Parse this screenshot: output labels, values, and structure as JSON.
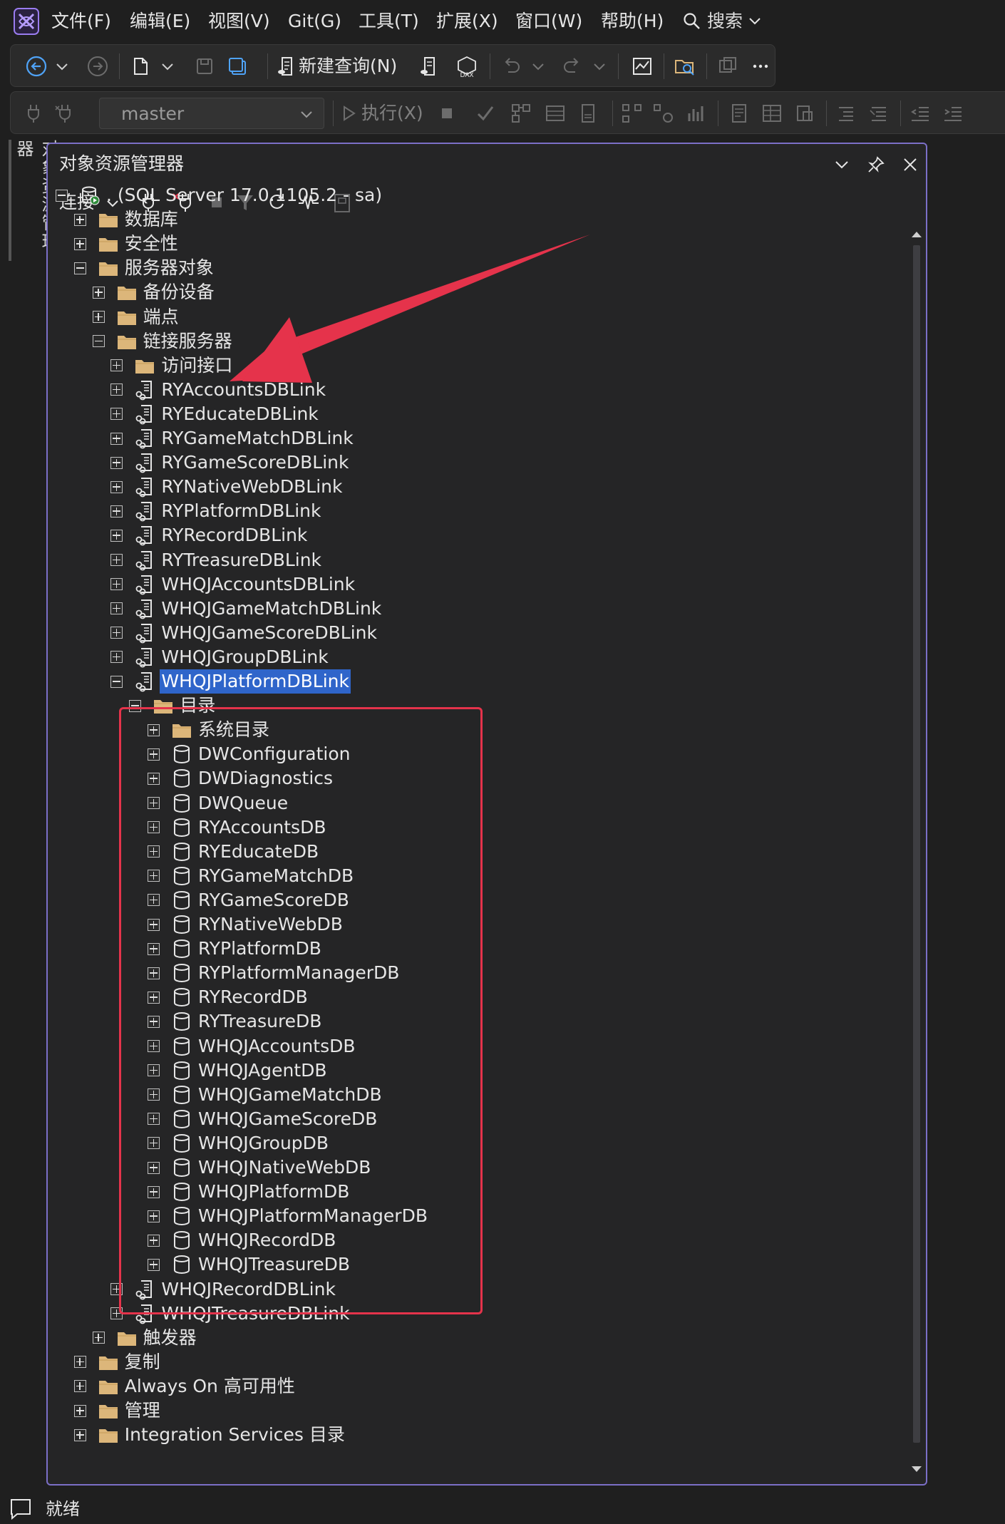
{
  "menubar": {
    "items": [
      "文件(F)",
      "编辑(E)",
      "视图(V)",
      "Git(G)",
      "工具(T)",
      "扩展(X)",
      "窗口(W)",
      "帮助(H)"
    ],
    "search_label": "搜索"
  },
  "toolbar1": {
    "new_query_label": "新建查询(N)",
    "dax_label": "DAX"
  },
  "toolbar2": {
    "database_selected": "master",
    "execute_label": "执行(X)"
  },
  "side_tab": {
    "label": "对象资源管理器"
  },
  "panel": {
    "title": "对象资源管理器",
    "connect_label": "连接"
  },
  "tree": [
    {
      "label": ". (SQL Server 17.0.1105.2 - sa)",
      "icon": "server-icon",
      "state": "expanded"
    },
    {
      "label": "数据库",
      "icon": "folder-icon",
      "state": "collapsed"
    },
    {
      "label": "安全性",
      "icon": "folder-icon",
      "state": "collapsed"
    },
    {
      "label": "服务器对象",
      "icon": "folder-icon",
      "state": "expanded"
    },
    {
      "label": "备份设备",
      "icon": "folder-icon",
      "state": "collapsed"
    },
    {
      "label": "端点",
      "icon": "folder-icon",
      "state": "collapsed"
    },
    {
      "label": "链接服务器",
      "icon": "folder-icon",
      "state": "expanded"
    },
    {
      "label": "访问接口",
      "icon": "folder-icon",
      "state": "collapsed"
    },
    {
      "label": "RYAccountsDBLink",
      "icon": "linked-server-icon",
      "state": "collapsed"
    },
    {
      "label": "RYEducateDBLink",
      "icon": "linked-server-icon",
      "state": "collapsed"
    },
    {
      "label": "RYGameMatchDBLink",
      "icon": "linked-server-icon",
      "state": "collapsed"
    },
    {
      "label": "RYGameScoreDBLink",
      "icon": "linked-server-icon",
      "state": "collapsed"
    },
    {
      "label": "RYNativeWebDBLink",
      "icon": "linked-server-icon",
      "state": "collapsed"
    },
    {
      "label": "RYPlatformDBLink",
      "icon": "linked-server-icon",
      "state": "collapsed"
    },
    {
      "label": "RYRecordDBLink",
      "icon": "linked-server-icon",
      "state": "collapsed"
    },
    {
      "label": "RYTreasureDBLink",
      "icon": "linked-server-icon",
      "state": "collapsed"
    },
    {
      "label": "WHQJAccountsDBLink",
      "icon": "linked-server-icon",
      "state": "collapsed"
    },
    {
      "label": "WHQJGameMatchDBLink",
      "icon": "linked-server-icon",
      "state": "collapsed"
    },
    {
      "label": "WHQJGameScoreDBLink",
      "icon": "linked-server-icon",
      "state": "collapsed"
    },
    {
      "label": "WHQJGroupDBLink",
      "icon": "linked-server-icon",
      "state": "collapsed"
    },
    {
      "label": "WHQJPlatformDBLink",
      "icon": "linked-server-icon",
      "state": "expanded",
      "selected": true
    },
    {
      "label": "目录",
      "icon": "folder-icon",
      "state": "expanded"
    },
    {
      "label": "系统目录",
      "icon": "folder-icon",
      "state": "collapsed"
    },
    {
      "label": "DWConfiguration",
      "icon": "database-icon",
      "state": "collapsed"
    },
    {
      "label": "DWDiagnostics",
      "icon": "database-icon",
      "state": "collapsed"
    },
    {
      "label": "DWQueue",
      "icon": "database-icon",
      "state": "collapsed"
    },
    {
      "label": "RYAccountsDB",
      "icon": "database-icon",
      "state": "collapsed"
    },
    {
      "label": "RYEducateDB",
      "icon": "database-icon",
      "state": "collapsed"
    },
    {
      "label": "RYGameMatchDB",
      "icon": "database-icon",
      "state": "collapsed"
    },
    {
      "label": "RYGameScoreDB",
      "icon": "database-icon",
      "state": "collapsed"
    },
    {
      "label": "RYNativeWebDB",
      "icon": "database-icon",
      "state": "collapsed"
    },
    {
      "label": "RYPlatformDB",
      "icon": "database-icon",
      "state": "collapsed"
    },
    {
      "label": "RYPlatformManagerDB",
      "icon": "database-icon",
      "state": "collapsed"
    },
    {
      "label": "RYRecordDB",
      "icon": "database-icon",
      "state": "collapsed"
    },
    {
      "label": "RYTreasureDB",
      "icon": "database-icon",
      "state": "collapsed"
    },
    {
      "label": "WHQJAccountsDB",
      "icon": "database-icon",
      "state": "collapsed"
    },
    {
      "label": "WHQJAgentDB",
      "icon": "database-icon",
      "state": "collapsed"
    },
    {
      "label": "WHQJGameMatchDB",
      "icon": "database-icon",
      "state": "collapsed"
    },
    {
      "label": "WHQJGameScoreDB",
      "icon": "database-icon",
      "state": "collapsed"
    },
    {
      "label": "WHQJGroupDB",
      "icon": "database-icon",
      "state": "collapsed"
    },
    {
      "label": "WHQJNativeWebDB",
      "icon": "database-icon",
      "state": "collapsed"
    },
    {
      "label": "WHQJPlatformDB",
      "icon": "database-icon",
      "state": "collapsed"
    },
    {
      "label": "WHQJPlatformManagerDB",
      "icon": "database-icon",
      "state": "collapsed"
    },
    {
      "label": "WHQJRecordDB",
      "icon": "database-icon",
      "state": "collapsed"
    },
    {
      "label": "WHQJTreasureDB",
      "icon": "database-icon",
      "state": "collapsed"
    },
    {
      "label": "WHQJRecordDBLink",
      "icon": "linked-server-icon",
      "state": "collapsed"
    },
    {
      "label": "WHQJTreasureDBLink",
      "icon": "linked-server-icon",
      "state": "collapsed"
    },
    {
      "label": "触发器",
      "icon": "folder-icon",
      "state": "collapsed"
    },
    {
      "label": "复制",
      "icon": "folder-icon",
      "state": "collapsed"
    },
    {
      "label": "Always On 高可用性",
      "icon": "folder-icon",
      "state": "collapsed"
    },
    {
      "label": "管理",
      "icon": "folder-icon",
      "state": "collapsed"
    },
    {
      "label": "Integration Services 目录",
      "icon": "folder-icon",
      "state": "collapsed"
    }
  ],
  "statusbar": {
    "text": "就绪"
  },
  "colors": {
    "accent_border": "#7b6fc7",
    "selection": "#2f65ca",
    "annotation_red": "#e5334b",
    "folder": "#dcb67a"
  }
}
